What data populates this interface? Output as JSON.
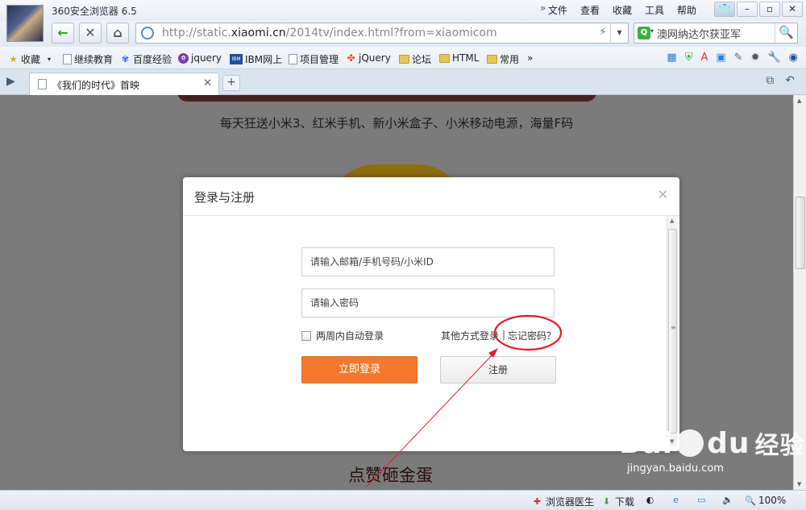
{
  "app": {
    "title": "360安全浏览器 6.5"
  },
  "menu": [
    "文件",
    "查看",
    "收藏",
    "工具",
    "帮助"
  ],
  "nav": {
    "url_prefix": "http://static.",
    "url_host": "xiaomi.cn",
    "url_rest": "/2014tv/index.html?from=xiaomicom",
    "search_value": "澳网纳达尔获亚军"
  },
  "bookmarks": [
    {
      "label": "收藏",
      "icon": "star-icon"
    },
    {
      "label": "继续教育",
      "icon": "page-icon"
    },
    {
      "label": "百度经验",
      "icon": "paw-icon"
    },
    {
      "label": "jquery",
      "icon": "jquery-icon"
    },
    {
      "label": "IBM网上",
      "icon": "ibm-icon"
    },
    {
      "label": "项目管理",
      "icon": "page-icon"
    },
    {
      "label": "jQuery",
      "icon": "puzzle-icon"
    },
    {
      "label": "论坛",
      "icon": "folder-icon"
    },
    {
      "label": "HTML",
      "icon": "folder-icon"
    },
    {
      "label": "常用",
      "icon": "folder-icon"
    }
  ],
  "tab": {
    "title": "《我们的时代》首映"
  },
  "page": {
    "subtitle": "每天狂送小米3、红米手机、新小米盒子、小米移动电源，海量F码",
    "footer": "点赞砸金蛋"
  },
  "modal": {
    "title": "登录与注册",
    "user_placeholder": "请输入邮箱/手机号码/小米ID",
    "pass_placeholder": "请输入密码",
    "remember_label": "两周内自动登录",
    "other_label": "其他方式登录",
    "separator": "|",
    "forgot_label": "忘记密码？",
    "login_label": "立即登录",
    "register_label": "注册"
  },
  "status": {
    "doctor_label": "浏览器医生",
    "download_label": "下载",
    "zoom": "100%"
  },
  "watermark": {
    "logo": "Bai",
    "logo2": "du",
    "cn": "经验",
    "site": "jingyan.baidu.com"
  },
  "colors": {
    "accent": "#f4782d",
    "annotation": "#e0202a",
    "overlay": "#7b7b7b"
  }
}
